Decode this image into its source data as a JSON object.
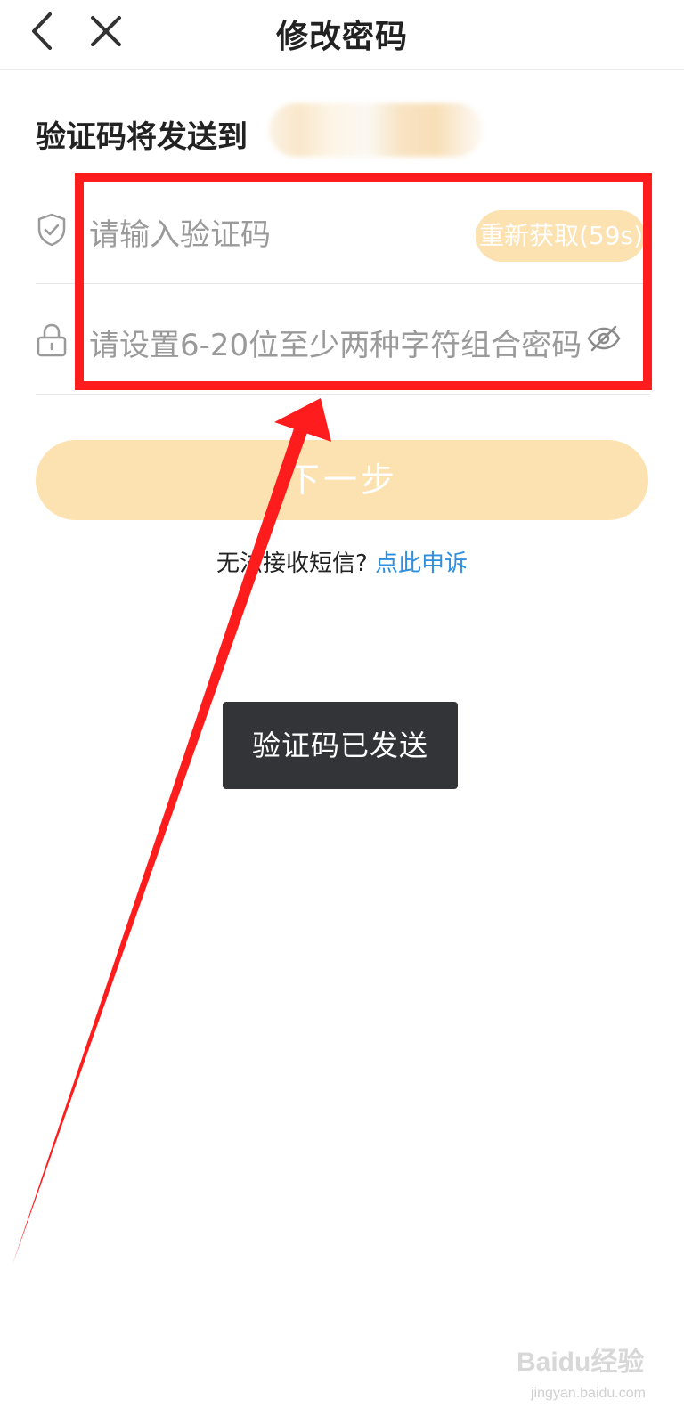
{
  "navbar": {
    "back_icon": "chevron-left-icon",
    "close_icon": "close-icon",
    "title": "修改密码"
  },
  "sent_to": {
    "label": "验证码将发送到"
  },
  "form": {
    "code": {
      "icon": "shield-check-icon",
      "placeholder": "请输入验证码",
      "resend_label": "重新获取(59s)"
    },
    "password": {
      "icon": "lock-icon",
      "placeholder": "请设置6-20位至少两种字符组合密码",
      "toggle_icon": "eye-off-icon"
    }
  },
  "next_button": {
    "label": "下一步"
  },
  "help": {
    "text": "无法接收短信?",
    "link": "点此申诉"
  },
  "toast": {
    "message": "验证码已发送"
  },
  "watermark": {
    "logo": "Baidu经验",
    "sub": "jingyan.baidu.com"
  },
  "colors": {
    "accent_disabled": "#fbe2b0",
    "link": "#2f8fdc",
    "annotation": "#ff1c1c",
    "toast_bg": "#333438"
  }
}
